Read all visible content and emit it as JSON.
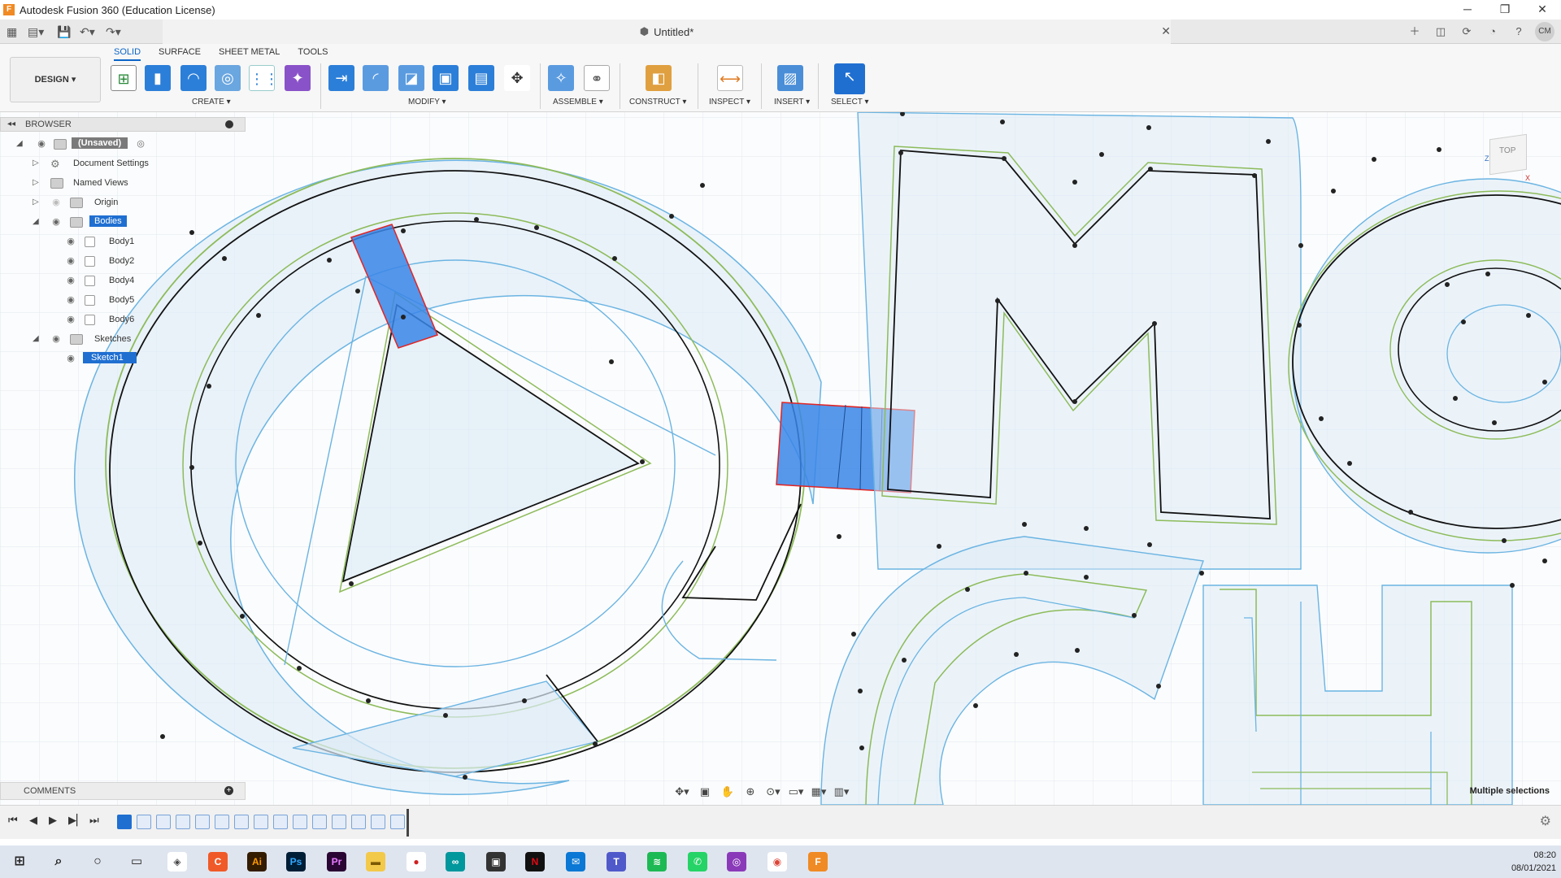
{
  "window": {
    "title": "Autodesk Fusion 360 (Education License)",
    "logo": "F"
  },
  "document": {
    "tab_title": "Untitled*"
  },
  "account": {
    "initials": "CM"
  },
  "ribbon": {
    "workspace": "DESIGN ▾",
    "tabs": [
      "SOLID",
      "SURFACE",
      "SHEET METAL",
      "TOOLS"
    ],
    "active_tab": "SOLID",
    "groups": [
      "CREATE ▾",
      "MODIFY ▾",
      "ASSEMBLE ▾",
      "CONSTRUCT ▾",
      "INSPECT ▾",
      "INSERT ▾",
      "SELECT ▾"
    ]
  },
  "browser": {
    "title": "BROWSER",
    "root": "(Unsaved)",
    "items": {
      "document_settings": "Document Settings",
      "named_views": "Named Views",
      "origin": "Origin",
      "bodies": "Bodies",
      "body1": "Body1",
      "body2": "Body2",
      "body4": "Body4",
      "body5": "Body5",
      "body6": "Body6",
      "sketches": "Sketches",
      "sketch1": "Sketch1"
    }
  },
  "viewcube": {
    "label": "TOP"
  },
  "comments": {
    "label": "COMMENTS"
  },
  "status": {
    "text": "Multiple selections"
  },
  "taskbar": {
    "time": "08:20",
    "date": "08/01/2021"
  },
  "colors": {
    "accent": "#1f6fd1",
    "sketch_profile": "#dbe9f5",
    "sketch_line_blue": "#5aaee0",
    "sketch_line_green": "#8dbb5a",
    "selected_body": "#3a86e8"
  }
}
